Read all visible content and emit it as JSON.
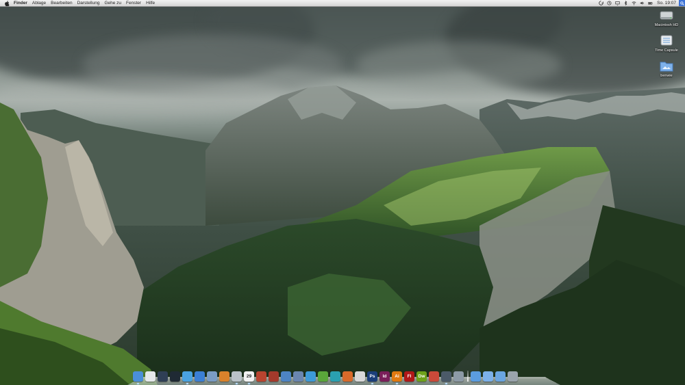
{
  "menubar": {
    "items": [
      "Finder",
      "Ablage",
      "Bearbeiten",
      "Darstellung",
      "Gehe zu",
      "Fenster",
      "Hilfe"
    ],
    "clock": "So. 19:07"
  },
  "desktop": {
    "icons": [
      {
        "label": "Macintosh HD",
        "icon": "hard-drive-icon"
      },
      {
        "label": "Time Capsule",
        "icon": "time-capsule-icon"
      },
      {
        "label": "benwie",
        "icon": "user-folder-icon"
      }
    ]
  },
  "dock": {
    "calendar_day": "29",
    "apps": [
      {
        "name": "finder",
        "color": "#4a8fd8"
      },
      {
        "name": "app-cube",
        "color": "#e5e8ea"
      },
      {
        "name": "dashboard",
        "color": "#2f3f55"
      },
      {
        "name": "time-machine",
        "color": "#1f2a34"
      },
      {
        "name": "safari",
        "color": "#4aa3e0"
      },
      {
        "name": "itunes",
        "color": "#3b7fd4"
      },
      {
        "name": "preview",
        "color": "#7a9cc4"
      },
      {
        "name": "iphoto",
        "color": "#d9822b"
      },
      {
        "name": "mail",
        "color": "#b9c2c8"
      },
      {
        "name": "ical",
        "color": "#f1f1f1"
      },
      {
        "name": "address-book",
        "color": "#b8442f"
      },
      {
        "name": "photo-booth",
        "color": "#a33a2b"
      },
      {
        "name": "script-editor",
        "color": "#4d84c4"
      },
      {
        "name": "xcode",
        "color": "#6a86b0"
      },
      {
        "name": "app-blue",
        "color": "#3d9ad8"
      },
      {
        "name": "app-green",
        "color": "#5aa63a"
      },
      {
        "name": "app-teal",
        "color": "#2aa0b0"
      },
      {
        "name": "app-orange",
        "color": "#d86a2a"
      },
      {
        "name": "acrobat",
        "color": "#d8d8d8"
      },
      {
        "name": "photoshop",
        "label": "Ps",
        "color": "#1b3e7a"
      },
      {
        "name": "indesign",
        "label": "Id",
        "color": "#7a1f5a"
      },
      {
        "name": "illustrator",
        "label": "Ai",
        "color": "#e07a10"
      },
      {
        "name": "flash",
        "label": "Fl",
        "color": "#b01818"
      },
      {
        "name": "dreamweaver",
        "label": "Dw",
        "color": "#6ea21a"
      },
      {
        "name": "app-grid",
        "color": "#c94a3a"
      },
      {
        "name": "activity-monitor",
        "color": "#4b5a68"
      },
      {
        "name": "system-preferences",
        "color": "#8d9aa6"
      }
    ],
    "right": [
      {
        "name": "documents-stack",
        "color": "#5b9de0"
      },
      {
        "name": "downloads-stack",
        "color": "#7bb0e8"
      },
      {
        "name": "applications-stack",
        "color": "#6aa5e0"
      },
      {
        "name": "trash",
        "color": "#9aa4ac"
      }
    ]
  }
}
